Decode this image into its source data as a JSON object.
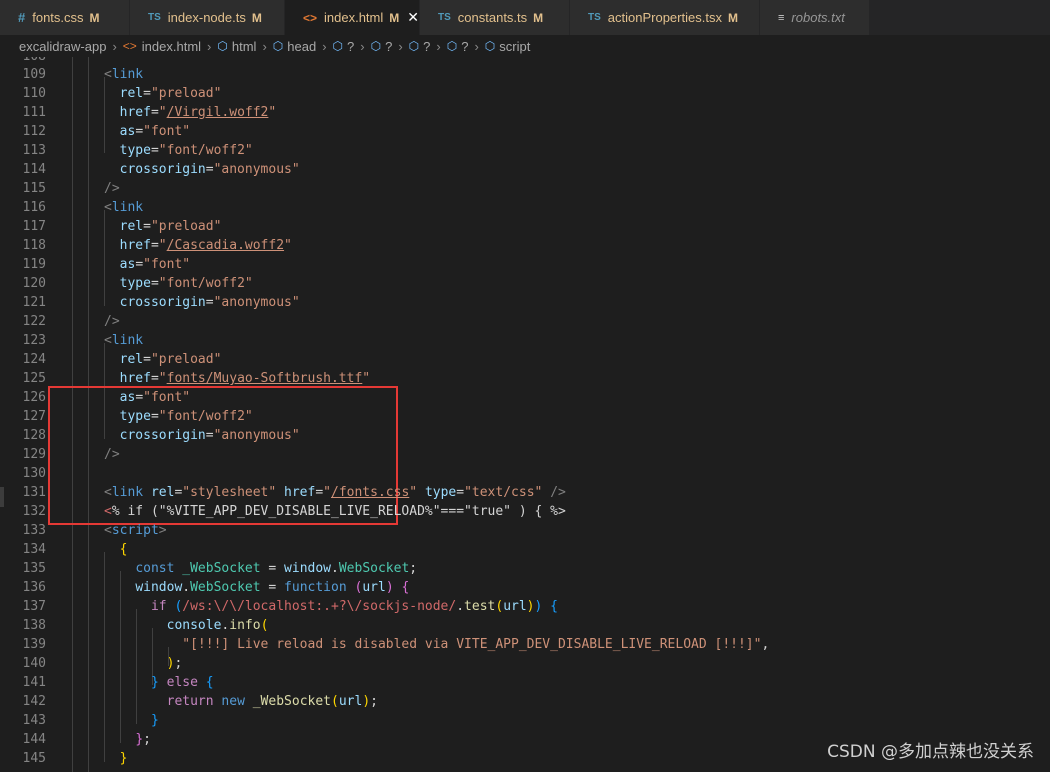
{
  "tabs": [
    {
      "icon": "#",
      "icon_kind": "css",
      "name": "fonts.css",
      "status": "M",
      "active": false
    },
    {
      "icon": "TS",
      "icon_kind": "ts",
      "name": "index-node.ts",
      "status": "M",
      "active": false
    },
    {
      "icon": "<>",
      "icon_kind": "html",
      "name": "index.html",
      "status": "M",
      "active": true,
      "close": "✕"
    },
    {
      "icon": "TS",
      "icon_kind": "ts",
      "name": "constants.ts",
      "status": "M",
      "active": false
    },
    {
      "icon": "TS",
      "icon_kind": "ts",
      "name": "actionProperties.tsx",
      "status": "M",
      "active": false
    },
    {
      "icon": "≡",
      "icon_kind": "txt",
      "name": "robots.txt",
      "status": "",
      "active": false
    }
  ],
  "breadcrumb": [
    "excalidraw-app",
    "index.html",
    "html",
    "head",
    "?",
    "?",
    "?",
    "?",
    "script"
  ],
  "watermark": "CSDN @多加点辣也没关系",
  "code_lines": [
    {
      "n": "109",
      "html": "<span class=\"p\">&lt;</span><span class=\"t\">link</span>"
    },
    {
      "n": "110",
      "html": "  <span class=\"a\">rel</span>=<span class=\"s\">\"preload\"</span>"
    },
    {
      "n": "111",
      "html": "  <span class=\"a\">href</span>=<span class=\"s\">\"</span><span class=\"u\">/Virgil.woff2</span><span class=\"s\">\"</span>"
    },
    {
      "n": "112",
      "html": "  <span class=\"a\">as</span>=<span class=\"s\">\"font\"</span>"
    },
    {
      "n": "113",
      "html": "  <span class=\"a\">type</span>=<span class=\"s\">\"font/woff2\"</span>"
    },
    {
      "n": "114",
      "html": "  <span class=\"a\">crossorigin</span>=<span class=\"s\">\"anonymous\"</span>"
    },
    {
      "n": "115",
      "html": "<span class=\"p\">/&gt;</span>"
    },
    {
      "n": "116",
      "html": "<span class=\"p\">&lt;</span><span class=\"t\">link</span>"
    },
    {
      "n": "117",
      "html": "  <span class=\"a\">rel</span>=<span class=\"s\">\"preload\"</span>"
    },
    {
      "n": "118",
      "html": "  <span class=\"a\">href</span>=<span class=\"s\">\"</span><span class=\"u\">/Cascadia.woff2</span><span class=\"s\">\"</span>"
    },
    {
      "n": "119",
      "html": "  <span class=\"a\">as</span>=<span class=\"s\">\"font\"</span>"
    },
    {
      "n": "120",
      "html": "  <span class=\"a\">type</span>=<span class=\"s\">\"font/woff2\"</span>"
    },
    {
      "n": "121",
      "html": "  <span class=\"a\">crossorigin</span>=<span class=\"s\">\"anonymous\"</span>"
    },
    {
      "n": "122",
      "html": "<span class=\"p\">/&gt;</span>"
    },
    {
      "n": "123",
      "html": "<span class=\"p\">&lt;</span><span class=\"t\">link</span>"
    },
    {
      "n": "124",
      "html": "  <span class=\"a\">rel</span>=<span class=\"s\">\"preload\"</span>"
    },
    {
      "n": "125",
      "html": "  <span class=\"a\">href</span>=<span class=\"s\">\"</span><span class=\"u\">fonts/Muyao-Softbrush.ttf</span><span class=\"s\">\"</span>"
    },
    {
      "n": "126",
      "html": "  <span class=\"a\">as</span>=<span class=\"s\">\"font\"</span>"
    },
    {
      "n": "127",
      "html": "  <span class=\"a\">type</span>=<span class=\"s\">\"font/woff2\"</span>"
    },
    {
      "n": "128",
      "html": "  <span class=\"a\">crossorigin</span>=<span class=\"s\">\"anonymous\"</span>"
    },
    {
      "n": "129",
      "html": "<span class=\"p\">/&gt;</span>"
    },
    {
      "n": "130",
      "html": ""
    },
    {
      "n": "131",
      "html": "<span class=\"p\">&lt;</span><span class=\"t\">link</span> <span class=\"a\">rel</span>=<span class=\"s\">\"stylesheet\"</span> <span class=\"a\">href</span>=<span class=\"s\">\"</span><span class=\"u\">/fonts.css</span><span class=\"s\">\"</span> <span class=\"a\">type</span>=<span class=\"s\">\"text/css\"</span> <span class=\"p\">/&gt;</span>"
    },
    {
      "n": "132",
      "html": "<span class=\"r\">&lt;</span><span class=\"d\">% if (</span><span class=\"d\">\"%VITE_APP_DEV_DISABLE_LIVE_RELOAD%\"===\"true\" ) { %&gt;</span>"
    },
    {
      "n": "133",
      "html": "<span class=\"p\">&lt;</span><span class=\"t\">script</span><span class=\"p\">&gt;</span>"
    },
    {
      "n": "134",
      "html": "  <span class=\"y\">{</span>"
    },
    {
      "n": "135",
      "html": "    <span class=\"k\">const</span> <span class=\"c\">_WebSocket</span> = <span class=\"v\">window</span>.<span class=\"c\">WebSocket</span>;"
    },
    {
      "n": "136",
      "html": "    <span class=\"v\">window</span>.<span class=\"c\">WebSocket</span> = <span class=\"k\">function</span> <span class=\"m\">(</span><span class=\"v\">url</span><span class=\"m\">)</span> <span class=\"m\">{</span>"
    },
    {
      "n": "137",
      "html": "      <span class=\"cf\">if</span> <span class=\"b2\">(</span><span class=\"r\">/ws:\\/\\/localhost:.+?\\/sockjs-node/</span>.<span class=\"f\">test</span><span class=\"y\">(</span><span class=\"v\">url</span><span class=\"y\">)</span><span class=\"b2\">)</span> <span class=\"b2\">{</span>"
    },
    {
      "n": "138",
      "html": "        <span class=\"v\">console</span>.<span class=\"f\">info</span><span class=\"y\">(</span>"
    },
    {
      "n": "139",
      "html": "          <span class=\"s\">\"[!!!] Live reload is disabled via VITE_APP_DEV_DISABLE_LIVE_RELOAD [!!!]\"</span>,"
    },
    {
      "n": "140",
      "html": "        <span class=\"y\">)</span>;"
    },
    {
      "n": "141",
      "html": "      <span class=\"b2\">}</span> <span class=\"cf\">else</span> <span class=\"b2\">{</span>"
    },
    {
      "n": "142",
      "html": "        <span class=\"cf\">return</span> <span class=\"k\">new</span> <span class=\"f\">_WebSocket</span><span class=\"y\">(</span><span class=\"v\">url</span><span class=\"y\">)</span>;"
    },
    {
      "n": "143",
      "html": "      <span class=\"b2\">}</span>"
    },
    {
      "n": "144",
      "html": "    <span class=\"m\">}</span>;"
    },
    {
      "n": "145",
      "html": "  <span class=\"y\">}</span>"
    }
  ]
}
